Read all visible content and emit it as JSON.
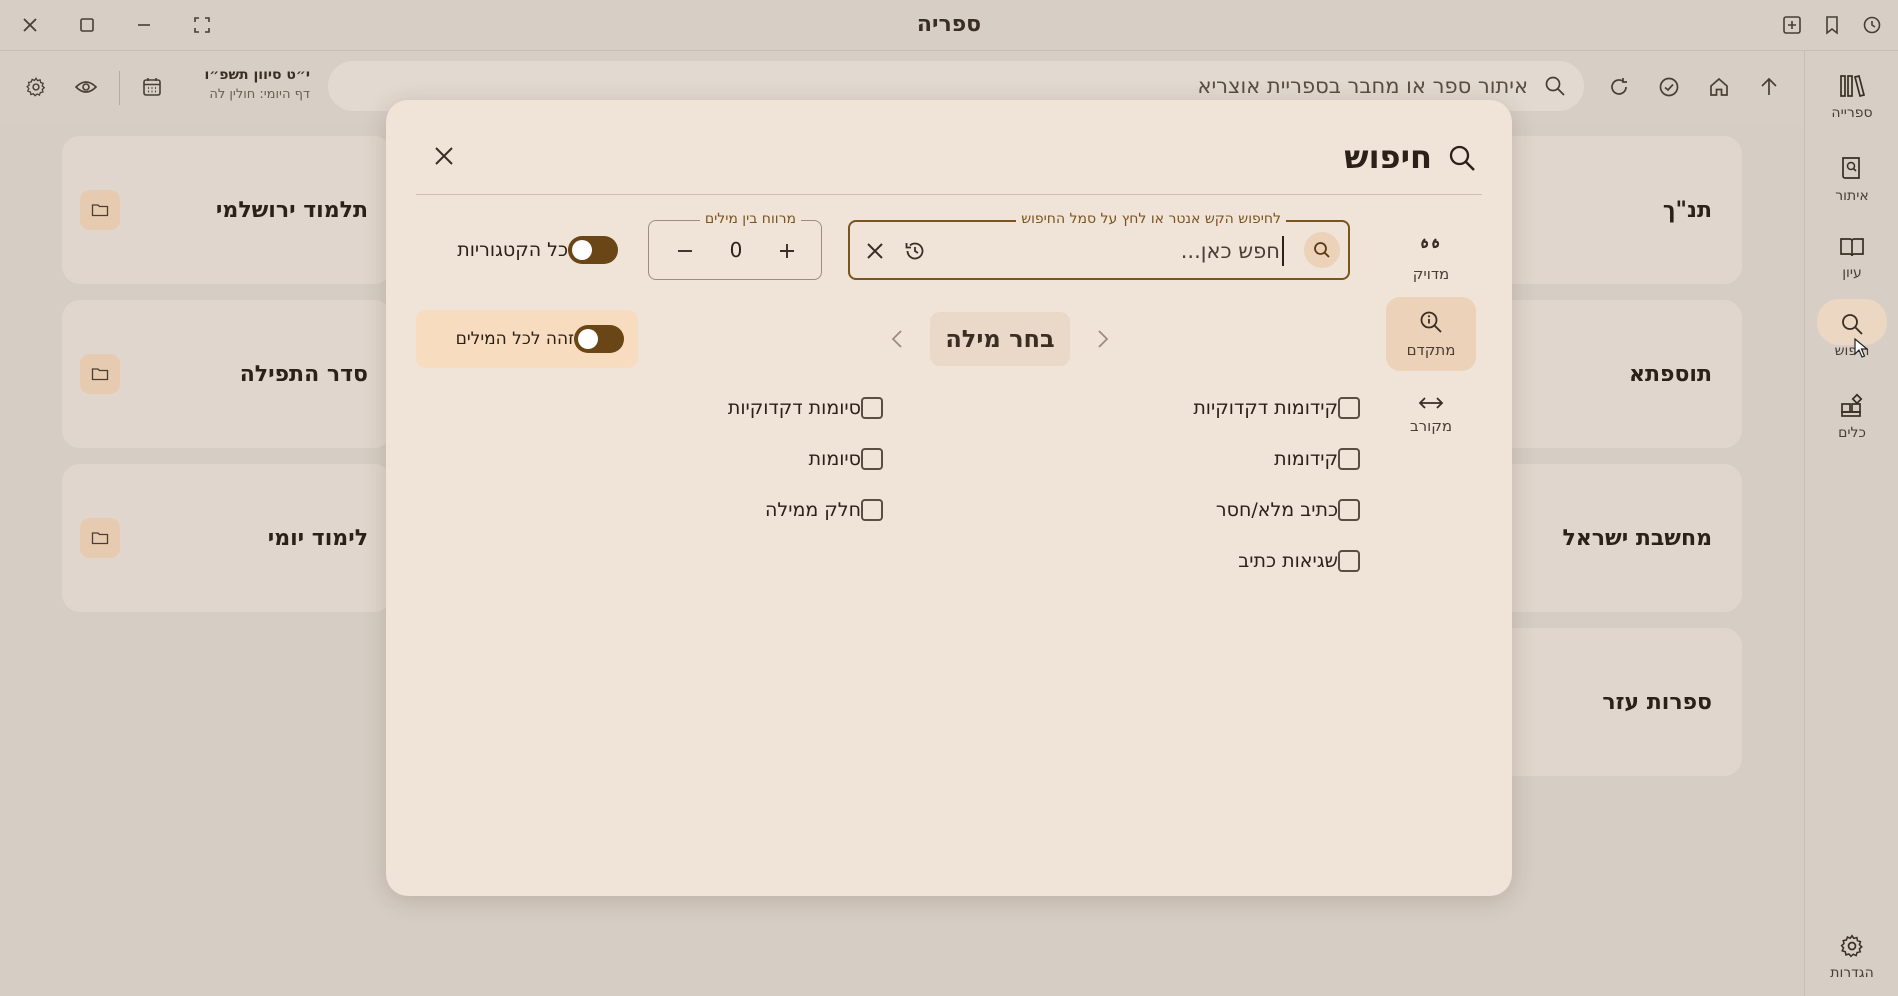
{
  "window": {
    "title": "ספריה"
  },
  "toolbar": {
    "search_placeholder": "איתור ספר או מחבר בספריית אוצריא",
    "date_title": "י״ט סיוון תשפ״ו",
    "date_sub": "דף היומי: חולין לה"
  },
  "sidebar": {
    "items": [
      {
        "label": "ספרייה",
        "icon": "library-icon"
      },
      {
        "label": "איתור",
        "icon": "book-search-icon"
      },
      {
        "label": "עיון",
        "icon": "open-book-icon"
      },
      {
        "label": "חיפוש",
        "icon": "search-icon"
      },
      {
        "label": "כלים",
        "icon": "tools-icon"
      }
    ],
    "settings_label": "הגדרות",
    "active": "חיפוש"
  },
  "library": {
    "left_cards": [
      "תלמוד ירושלמי",
      "סדר התפילה",
      "לימוד יומי"
    ],
    "right_cards": [
      "תנ\"ך",
      "תוספתא",
      "מחשבת ישראל",
      "ספרות עזר"
    ]
  },
  "dialog": {
    "title": "חיפוש",
    "modes": [
      {
        "label": "מדויק",
        "icon": "quote-icon"
      },
      {
        "label": "מתקדם",
        "icon": "advanced-search-icon"
      },
      {
        "label": "מקורב",
        "icon": "arrows-horizontal-icon"
      }
    ],
    "active_mode": "מתקדם",
    "query": {
      "hint": "לחיפוש הקש אנטר או לחץ על סמל החיפוש",
      "placeholder": "חפש כאן..."
    },
    "distance": {
      "label": "מרווח בין מילים",
      "value": "0"
    },
    "all_categories_label": "כל הקטגוריות",
    "word_selector": "בחר מילה",
    "apply_all_label": "זהה לכל המילים",
    "options_right": [
      "קידומות דקדוקיות",
      "קידומות",
      "כתיב מלא/חסר",
      "שגיאות כתיב"
    ],
    "options_left": [
      "סיומות דקדוקיות",
      "סיומות",
      "חלק ממילה"
    ]
  }
}
